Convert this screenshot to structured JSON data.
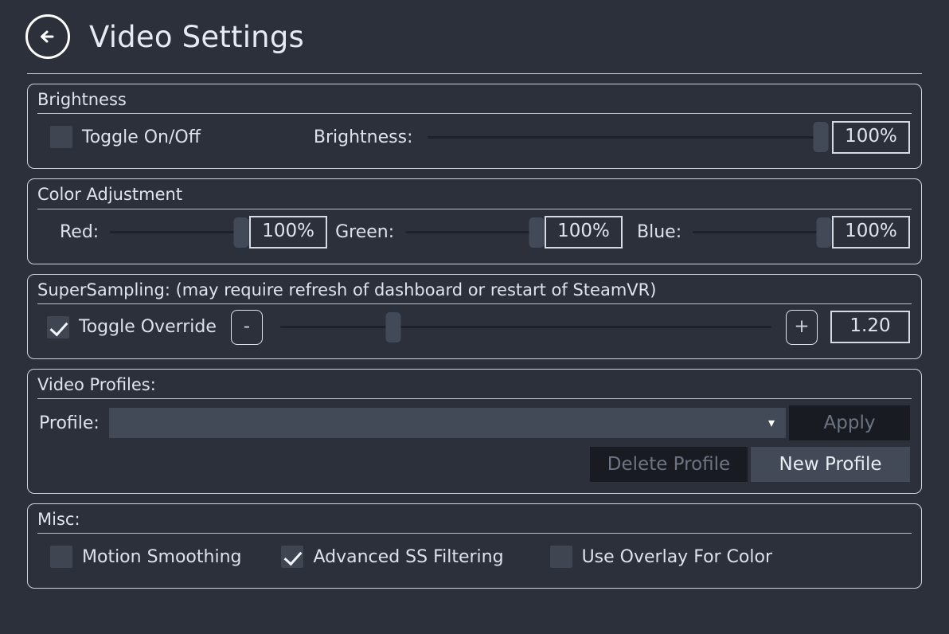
{
  "header": {
    "back_icon": "arrow-left-circle-icon",
    "title": "Video Settings"
  },
  "brightness": {
    "group_title": "Brightness",
    "toggle_label": "Toggle On/Off",
    "toggle_checked": false,
    "slider_label": "Brightness:",
    "slider_value_pct": 100,
    "value_text": "100%"
  },
  "color_adjustment": {
    "group_title": "Color Adjustment",
    "channels": [
      {
        "label": "Red:",
        "value_text": "100%",
        "value_pct": 100
      },
      {
        "label": "Green:",
        "value_text": "100%",
        "value_pct": 100
      },
      {
        "label": "Blue:",
        "value_text": "100%",
        "value_pct": 100
      }
    ]
  },
  "supersampling": {
    "group_title": "SuperSampling: (may require refresh of dashboard or restart of SteamVR)",
    "toggle_label": "Toggle Override",
    "toggle_checked": true,
    "minus_label": "-",
    "plus_label": "+",
    "slider_value_pct": 23,
    "value_text": "1.20"
  },
  "video_profiles": {
    "group_title": "Video Profiles:",
    "profile_label": "Profile:",
    "profile_selected": "",
    "chevron_icon": "chevron-down-icon",
    "apply_label": "Apply",
    "apply_enabled": false,
    "delete_label": "Delete Profile",
    "delete_enabled": false,
    "new_label": "New Profile",
    "new_enabled": true
  },
  "misc": {
    "group_title": "Misc:",
    "items": [
      {
        "label": "Motion Smoothing",
        "checked": false
      },
      {
        "label": "Advanced SS Filtering",
        "checked": true
      },
      {
        "label": "Use Overlay For Color",
        "checked": false
      }
    ]
  },
  "colors": {
    "background": "#2b303b",
    "border": "#cfd4dc",
    "text": "#dfe4ec",
    "control_fill": "#434a57",
    "track": "#1d212b",
    "disabled_bg": "#181b22",
    "disabled_text": "#6d7583"
  }
}
